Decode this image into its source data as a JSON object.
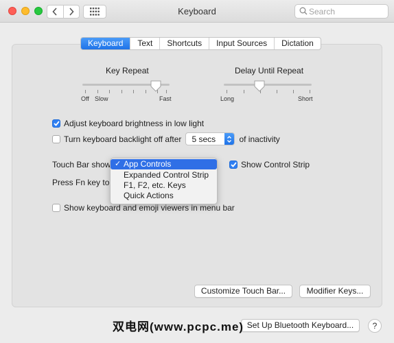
{
  "window": {
    "title": "Keyboard"
  },
  "search": {
    "placeholder": "Search"
  },
  "tabs": [
    {
      "label": "Keyboard",
      "selected": true
    },
    {
      "label": "Text",
      "selected": false
    },
    {
      "label": "Shortcuts",
      "selected": false
    },
    {
      "label": "Input Sources",
      "selected": false
    },
    {
      "label": "Dictation",
      "selected": false
    }
  ],
  "key_repeat": {
    "title": "Key Repeat",
    "labels": [
      "Off",
      "Slow",
      "Fast"
    ],
    "level": 0.875
  },
  "delay_until_repeat": {
    "title": "Delay Until Repeat",
    "labels": [
      "Long",
      "Short"
    ],
    "level": 0.4
  },
  "options": {
    "adjust_brightness": {
      "label": "Adjust keyboard brightness in low light",
      "checked": true
    },
    "backlight_off": {
      "label": "Turn keyboard backlight off after",
      "checked": false,
      "value": "5 secs",
      "suffix": "of inactivity"
    },
    "touch_bar_shows": {
      "label": "Touch Bar shows"
    },
    "show_control_strip": {
      "label": "Show Control Strip",
      "checked": true
    },
    "press_fn_key": {
      "label": "Press Fn key to"
    },
    "emoji_viewers": {
      "label": "Show keyboard and emoji viewers in menu bar",
      "checked": false
    }
  },
  "touch_bar_menu": {
    "check_mark": "✓",
    "items": [
      "App Controls",
      "Expanded Control Strip",
      "F1, F2, etc. Keys",
      "Quick Actions"
    ],
    "selected_index": 0
  },
  "buttons": {
    "customize_touch_bar": "Customize Touch Bar...",
    "modifier_keys": "Modifier Keys...",
    "bluetooth_keyboard": "Set Up Bluetooth Keyboard...",
    "help": "?"
  },
  "watermark": "双电网(www.pcpc.me)",
  "colors": {
    "accent": "#2f7ff2",
    "menu_highlight": "#2f6fe6"
  }
}
